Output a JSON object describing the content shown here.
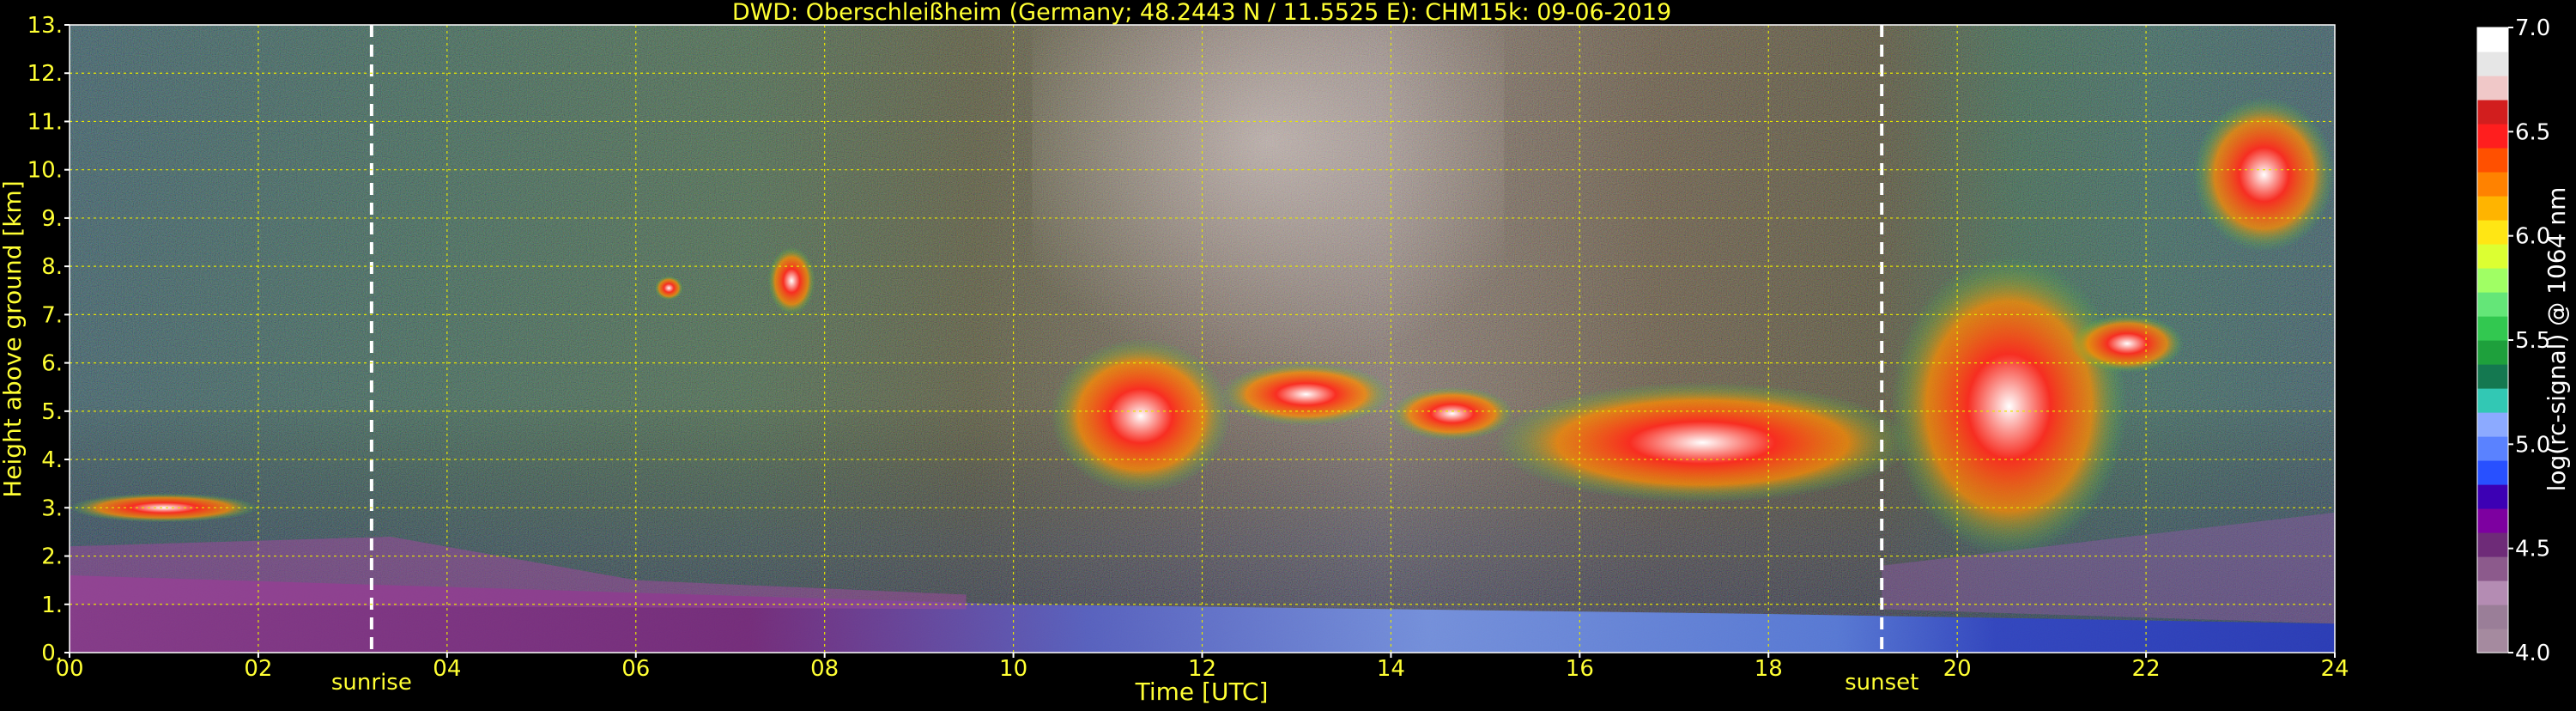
{
  "chart_data": {
    "type": "heatmap",
    "title": "DWD: Oberschleißheim (Germany; 48.2443 N / 11.5525 E):    CHM15k: 09-06-2019",
    "xlabel": "Time [UTC]",
    "ylabel": "Height above ground [km]",
    "x_ticks": [
      "00",
      "02",
      "04",
      "06",
      "08",
      "10",
      "12",
      "14",
      "16",
      "18",
      "20",
      "22",
      "24"
    ],
    "xlim": [
      0,
      24
    ],
    "y_ticks": [
      "0.",
      "1.",
      "2.",
      "3.",
      "4.",
      "5.",
      "6.",
      "7.",
      "8.",
      "9.",
      "10.",
      "11.",
      "12.",
      "13."
    ],
    "ylim": [
      0,
      13
    ],
    "grid": true,
    "annotations": [
      {
        "label": "sunrise",
        "x": 3.2
      },
      {
        "label": "sunset",
        "x": 19.2
      }
    ],
    "colorbar": {
      "label": "log(rc-signal) @ 1064 nm",
      "range": [
        4.0,
        7.0
      ],
      "tick_labels": [
        "4.0",
        "4.5",
        "5.0",
        "5.5",
        "6.0",
        "6.5",
        "7.0"
      ],
      "colors": [
        "#a58a9f",
        "#9a7e98",
        "#b48cb3",
        "#8c5a8c",
        "#6e2b78",
        "#7d00a0",
        "#3c00b4",
        "#2850ff",
        "#5a82ff",
        "#8caaff",
        "#32c8b4",
        "#147850",
        "#1ea03c",
        "#32c850",
        "#64e678",
        "#a0ff64",
        "#dcff32",
        "#ffe614",
        "#ffb400",
        "#ff8200",
        "#ff5000",
        "#ff1e1e",
        "#d21e1e",
        "#f0c8c8",
        "#e6e6e6",
        "#ffffff"
      ]
    },
    "features": [
      {
        "type": "boundary_layer",
        "x": [
          0,
          10,
          18,
          24
        ],
        "y": [
          1.6,
          1.0,
          0.8,
          0.6
        ]
      },
      {
        "type": "cloud",
        "x_range": [
          10.4,
          12.3
        ],
        "height_range": [
          3.3,
          6.5
        ]
      },
      {
        "type": "cloud",
        "x_range": [
          12.2,
          14.0
        ],
        "height_range": [
          4.7,
          6.0
        ]
      },
      {
        "type": "cloud",
        "x_range": [
          14.0,
          15.3
        ],
        "height_range": [
          4.4,
          5.5
        ]
      },
      {
        "type": "cloud",
        "x_range": [
          15.1,
          19.5
        ],
        "height_range": [
          3.1,
          5.6
        ]
      },
      {
        "type": "cloud",
        "x_range": [
          19.3,
          21.8
        ],
        "height_range": [
          2.0,
          8.2
        ]
      },
      {
        "type": "cloud",
        "x_range": [
          21.2,
          22.4
        ],
        "height_range": [
          5.8,
          7.0
        ]
      },
      {
        "type": "cloud",
        "x_range": [
          22.5,
          24.0
        ],
        "height_range": [
          8.3,
          11.5
        ]
      },
      {
        "type": "cloud",
        "x_range": [
          0.0,
          2.0
        ],
        "height_range": [
          2.7,
          3.3
        ]
      },
      {
        "type": "cloud",
        "x_range": [
          6.2,
          6.5
        ],
        "height_range": [
          7.3,
          7.8
        ]
      },
      {
        "type": "cloud",
        "x_range": [
          7.4,
          7.9
        ],
        "height_range": [
          7.0,
          8.4
        ]
      }
    ]
  }
}
